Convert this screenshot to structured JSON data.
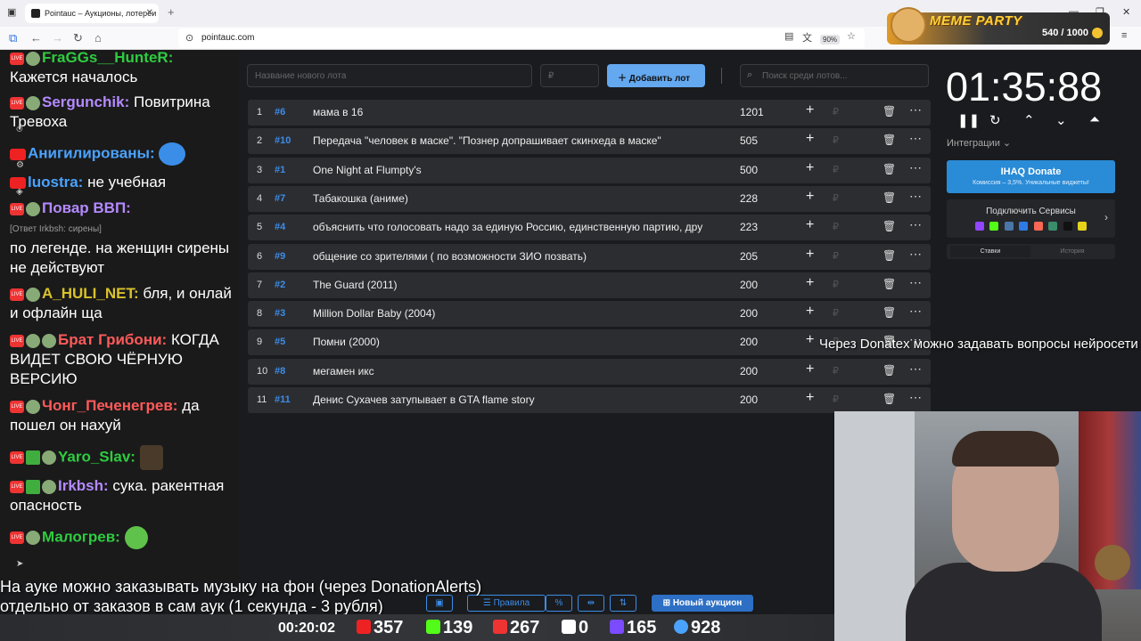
{
  "browser": {
    "tab_title": "Pointauc – Аукционы, лотереи",
    "url": "pointauc.com",
    "zoom": "90%"
  },
  "meme_party": {
    "logo": "MEME PARTY",
    "points": "540 / 1000"
  },
  "chat": {
    "messages": [
      {
        "user": "FraGGs__HunteR:",
        "text": "Кажется началось",
        "color": "#2ecc40"
      },
      {
        "user": "Sergunchik:",
        "text": "Повитрина Тревоха",
        "color": "#b48aff"
      },
      {
        "user": "Анигилированы:",
        "text": "",
        "color": "#4aa3ff"
      },
      {
        "user": "luostra:",
        "text": "не учебная",
        "color": "#4aa3ff"
      },
      {
        "user": "Повар ВВП:",
        "text": "",
        "color": "#b48aff"
      },
      {
        "user": "",
        "text": "по легенде. на женщин сирены не действуют",
        "color": "#fff"
      },
      {
        "user": "A_HULI_NET:",
        "text": "бля, и онлай и офлайн ща",
        "color": "#d9c22a"
      },
      {
        "user": "Брат Грибони:",
        "text": "КОГДА ВИДЕТ СВОЮ ЧЁРНУЮ ВЕРСИЮ",
        "color": "#ff5a5a"
      },
      {
        "user": "Чонг_Печенегрев:",
        "text": "да пошел он нахуй",
        "color": "#ff5a5a"
      },
      {
        "user": "Yaro_Slav:",
        "text": "",
        "color": "#2ecc40"
      },
      {
        "user": "Irkbsh:",
        "text": "сука. ракентная опасность",
        "color": "#b48aff"
      },
      {
        "user": "Малогрев:",
        "text": "",
        "color": "#2ecc40"
      }
    ],
    "reply_to": "[Ответ Irkbsh: сирены]"
  },
  "auction": {
    "new_lot_placeholder": "Название нового лота",
    "amount_placeholder": "₽",
    "add_lot_label": "Добавить лот",
    "search_placeholder": "Поиск среди лотов...",
    "lots": [
      {
        "n": "1",
        "id": "#6",
        "name": "мама в 16",
        "amount": "1201"
      },
      {
        "n": "2",
        "id": "#10",
        "name": "Передача \"человек в маске\". \"Познер допрашивает скинхеда в маске\"",
        "amount": "505"
      },
      {
        "n": "3",
        "id": "#1",
        "name": "One Night at Flumpty's",
        "amount": "500"
      },
      {
        "n": "4",
        "id": "#7",
        "name": "Табакошка (аниме)",
        "amount": "228"
      },
      {
        "n": "5",
        "id": "#4",
        "name": "объяснить что голосовать надо за единую Россию, единственную партию, дру",
        "amount": "223"
      },
      {
        "n": "6",
        "id": "#9",
        "name": "общение со зрителями ( по возможности ЗИО позвать)",
        "amount": "205"
      },
      {
        "n": "7",
        "id": "#2",
        "name": "The Guard (2011)",
        "amount": "200"
      },
      {
        "n": "8",
        "id": "#3",
        "name": "Million Dollar Baby (2004)",
        "amount": "200"
      },
      {
        "n": "9",
        "id": "#5",
        "name": "Помни (2000)",
        "amount": "200"
      },
      {
        "n": "10",
        "id": "#8",
        "name": "мегамен икс",
        "amount": "200"
      },
      {
        "n": "11",
        "id": "#11",
        "name": "Денис Сухачев затупывает в GTA flame story",
        "amount": "200"
      }
    ],
    "rub_sign": "₽"
  },
  "right_panel": {
    "timer": "01:35:88",
    "integrations_label": "Интеграции",
    "ihaq_title": "IHAQ Donate",
    "ihaq_sub": "Комиссия – 3,5%. Уникальные виджеты!",
    "services_title": "Подключить Сервисы",
    "tab_bids": "Ставки",
    "tab_history": "История"
  },
  "overlay": {
    "donatex": "Через Donatex можно задавать вопросы нейросети",
    "bottom_line1": "На ауке можно заказывать музыку на фон (через DonationAlerts)",
    "bottom_line2": "отдельно от заказов в сам аук (1 секунда - 3 рубля)"
  },
  "toolbar": {
    "rules": "Правила",
    "percent": "%",
    "new_auction": "Новый аукцион"
  },
  "status": {
    "time": "00:20:02",
    "youtube": "357",
    "kick": "139",
    "live": "267",
    "r": "0",
    "other": "165",
    "viewers": "928"
  }
}
